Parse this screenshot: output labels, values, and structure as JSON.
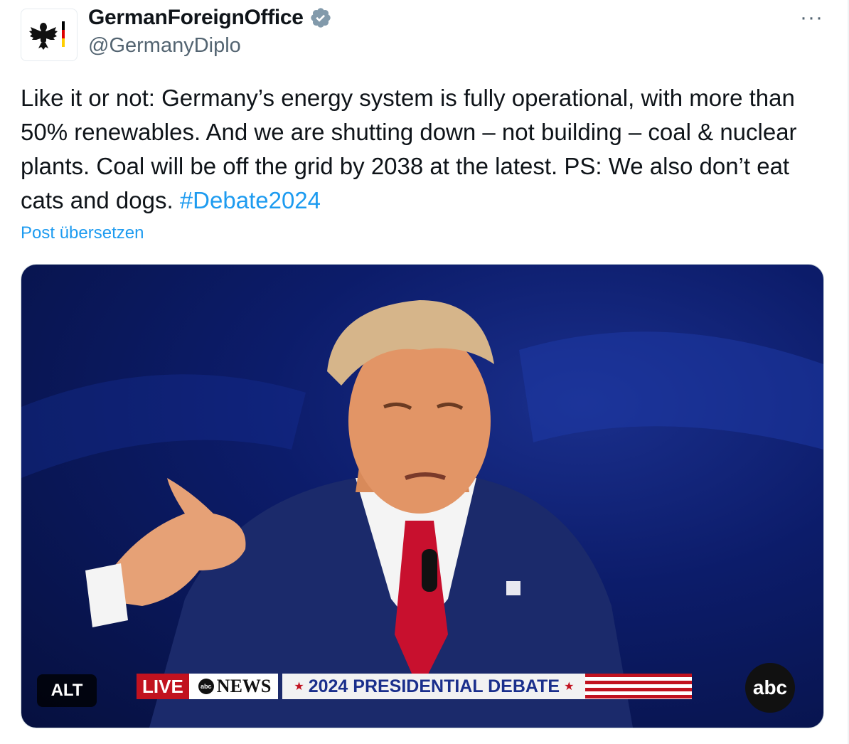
{
  "post": {
    "display_name": "GermanForeignOffice",
    "handle": "@GermanyDiplo",
    "verified_icon": "verified-badge-icon",
    "more_label": "···",
    "text": "Like it or not: Germany’s energy system is fully operational, with more than 50% renewables. And we are shutting down – not building – coal & nuclear plants. Coal will be off the grid by 2038 at the latest. PS: We also don’t eat cats and dogs.",
    "hashtag": "#Debate2024",
    "translate_label": "Post übersetzen"
  },
  "media": {
    "alt_label": "ALT",
    "live_label": "LIVE",
    "news_label": "NEWS",
    "news_logo_small": "abc",
    "debate_label": "2024 PRESIDENTIAL DEBATE",
    "network_bug": "abc"
  },
  "colors": {
    "link": "#1d9bf0",
    "secondary_text": "#536471",
    "verified": "#829aab"
  }
}
